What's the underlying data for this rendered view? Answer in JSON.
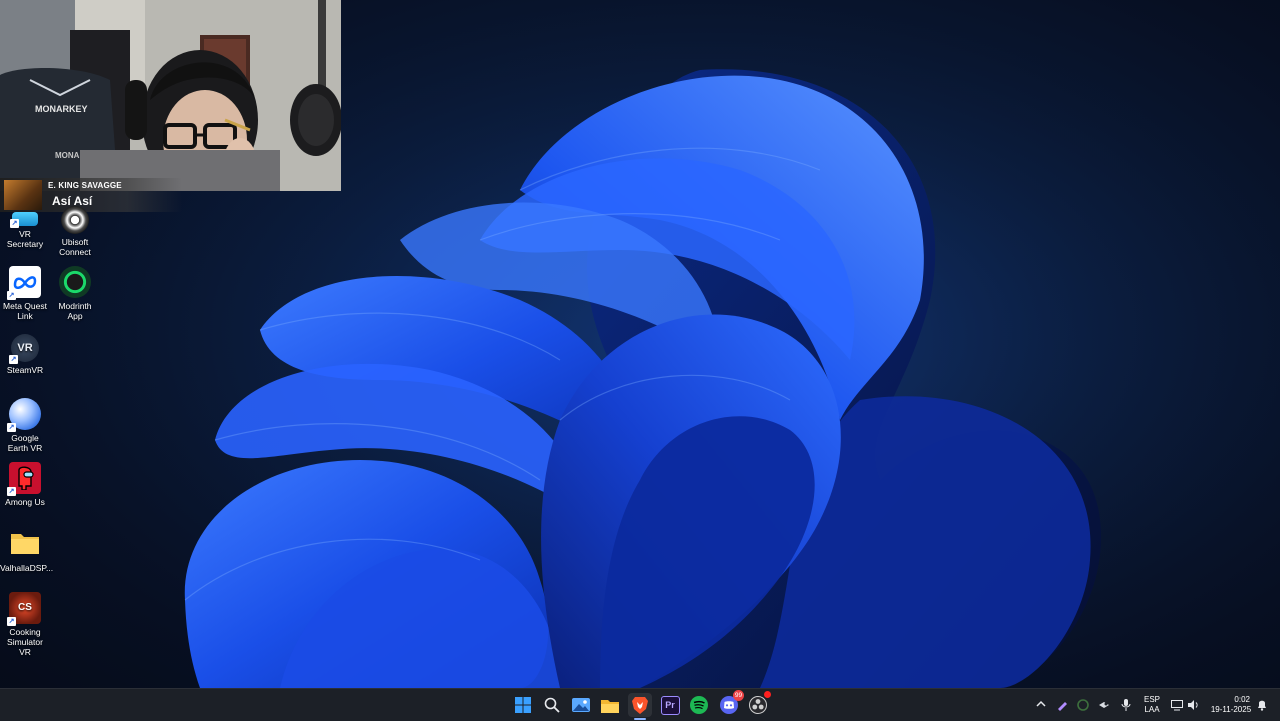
{
  "webcam": {
    "now_playing": {
      "artist": "E. KING SAVAGGE",
      "song": "Así Así"
    },
    "chair_brand": "MONARKEY"
  },
  "desktop_icons": [
    {
      "label": "VR Secretary",
      "icon": "vr-secretary-icon"
    },
    {
      "label": "Ubisoft Connect",
      "icon": "ubisoft-connect-icon"
    },
    {
      "label": "Meta Quest Link",
      "icon": "meta-quest-icon"
    },
    {
      "label": "Modrinth App",
      "icon": "modrinth-icon"
    },
    {
      "label": "SteamVR",
      "icon": "steamvr-icon"
    },
    {
      "label": "Google Earth VR",
      "icon": "google-earth-icon"
    },
    {
      "label": "Among Us",
      "icon": "among-us-icon"
    },
    {
      "label": "ValhallaDSP...",
      "icon": "folder-icon"
    },
    {
      "label": "Cooking Simulator VR",
      "icon": "cooking-simulator-icon"
    }
  ],
  "taskbar": {
    "apps": [
      "start",
      "search",
      "gallery",
      "file-explorer",
      "brave-browser",
      "premiere-pro",
      "spotify",
      "discord",
      "obs"
    ],
    "premiere_label": "Pr",
    "discord_badge": "99",
    "tray": {
      "language": "ESP",
      "layout": "LAA",
      "time": "0:02",
      "date": "19-11-2025"
    }
  },
  "colors": {
    "taskbar_bg": "#1c2027",
    "wallpaper_accent": "#2f6bff",
    "spotify_green": "#1db954",
    "brave_orange": "#fb542b"
  }
}
